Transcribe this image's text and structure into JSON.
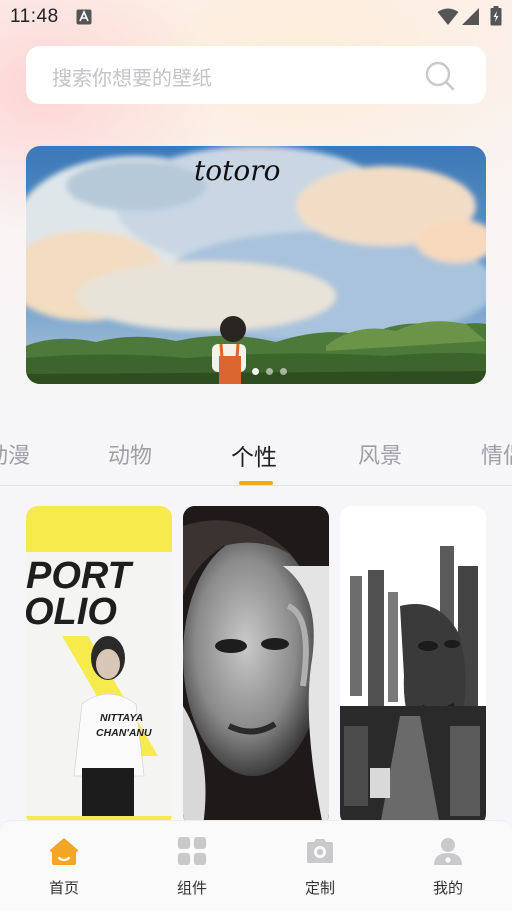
{
  "status_bar": {
    "time": "11:48",
    "icons": [
      "a-icon",
      "wifi-icon",
      "signal-icon",
      "battery-icon"
    ]
  },
  "search": {
    "placeholder": "搜索你想要的壁纸"
  },
  "banner": {
    "title_text": "totoro",
    "slide_count": 3,
    "active_slide": 1
  },
  "tabs": {
    "items": [
      {
        "label": "动漫"
      },
      {
        "label": "动物"
      },
      {
        "label": "个性"
      },
      {
        "label": "风景"
      },
      {
        "label": "情侣"
      }
    ],
    "active": "个性"
  },
  "wallpapers": [
    {
      "title_lines": [
        "PORT",
        "OLIO"
      ],
      "name_lines": [
        "NITTAYA",
        "CHAN'ANU"
      ],
      "accent": "#f7ea4d"
    },
    {
      "description": "bw-portrait"
    },
    {
      "description": "city-double-exposure"
    }
  ],
  "bottom_nav": {
    "items": [
      {
        "label": "首页",
        "icon": "home-icon",
        "active": true
      },
      {
        "label": "组件",
        "icon": "widgets-icon",
        "active": false
      },
      {
        "label": "定制",
        "icon": "camera-icon",
        "active": false
      },
      {
        "label": "我的",
        "icon": "profile-icon",
        "active": false
      }
    ]
  },
  "colors": {
    "accent": "#f3a623",
    "tab_active": "#222222",
    "tab_inactive": "#a0a0a4"
  }
}
